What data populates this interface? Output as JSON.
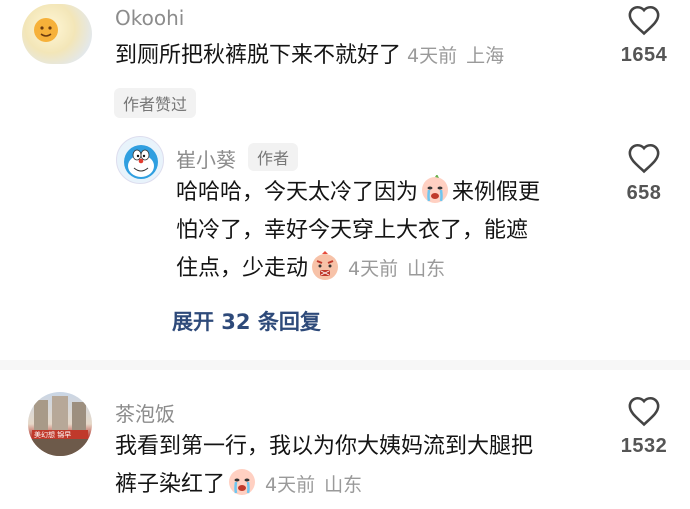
{
  "comments": [
    {
      "username": "Okoohi",
      "text": "到厕所把秋裤脱下来不就好了",
      "time": "4天前",
      "location": "上海",
      "likes": "1654",
      "badge": "作者赞过"
    },
    {
      "username": "崔小葵",
      "author_tag": "作者",
      "text_line1_a": "哈哈哈，今天太冷了因为",
      "text_line1_b": "来例假更",
      "text_line2": "怕冷了，幸好今天穿上大衣了，能遮",
      "text_line3": "住点，少走动",
      "time": "4天前",
      "location": "山东",
      "likes": "658",
      "expand_label": "展开 32 条回复"
    },
    {
      "username": "茶泡饭",
      "text_line1": "我看到第一行，我以为你大姨妈流到大腿把",
      "text_line2": "裤子染红了",
      "time": "4天前",
      "location": "山东",
      "likes": "1532"
    }
  ],
  "icons": {
    "heart": "heart-outline-icon",
    "crying_emoji": "crying-face-emoji-icon",
    "angry_emoji": "angry-face-emoji-icon"
  },
  "colors": {
    "link": "#2e4a7a",
    "meta": "#9a9a9a",
    "username": "#8c8c8c"
  }
}
